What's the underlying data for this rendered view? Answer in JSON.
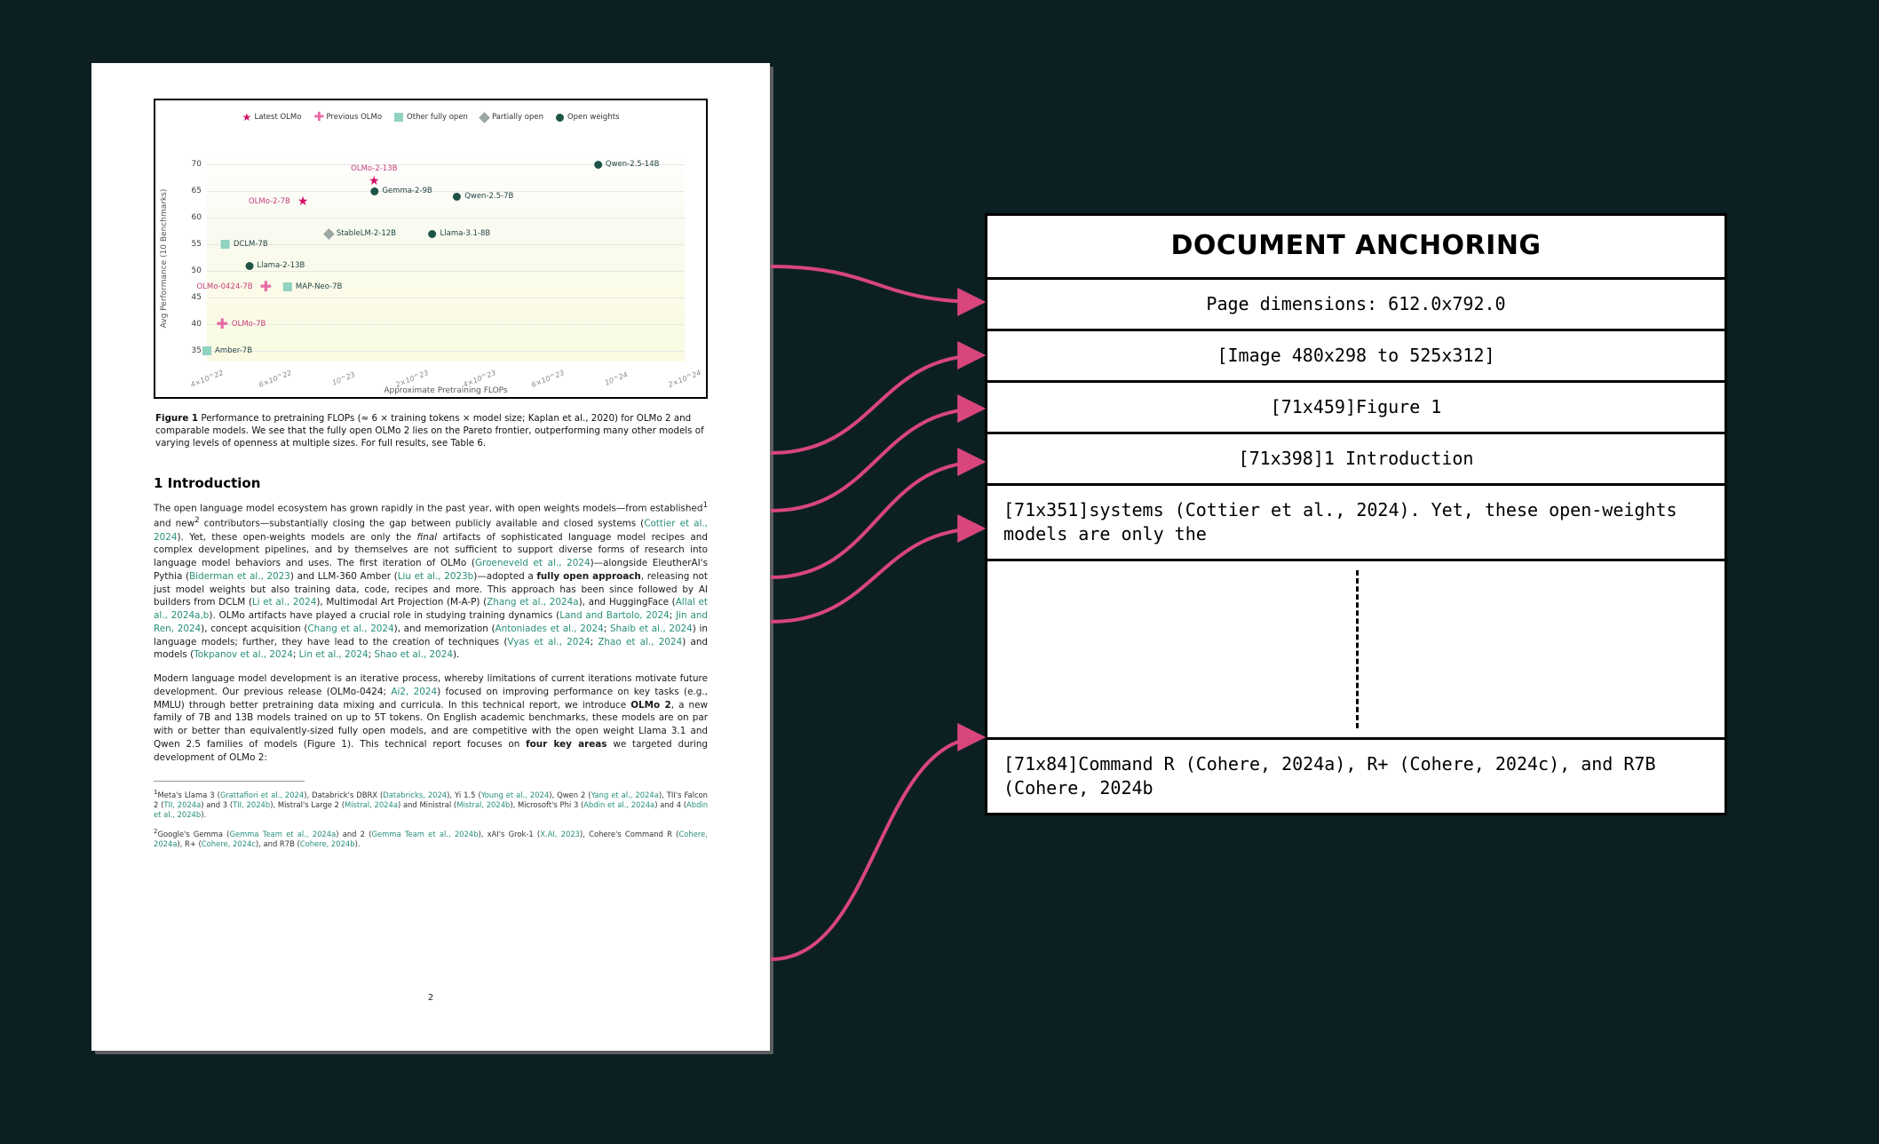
{
  "colors": {
    "bg": "#0c2024",
    "arrow": "#d8467c",
    "teal_link": "#278f7a"
  },
  "chart_data": {
    "type": "scatter",
    "title": "",
    "xlabel": "Approximate Pretraining FLOPs",
    "ylabel": "Avg Performance (10 Benchmarks)",
    "ylim": [
      33,
      73
    ],
    "yticks": [
      35,
      40,
      45,
      50,
      55,
      60,
      65,
      70
    ],
    "x_categories": [
      "4×10^22",
      "6×10^22",
      "10^23",
      "2×10^23",
      "4×10^23",
      "6×10^23",
      "10^24",
      "2×10^24"
    ],
    "legend": [
      {
        "marker": "star",
        "label": "Latest OLMo"
      },
      {
        "marker": "plus",
        "label": "Previous OLMo"
      },
      {
        "marker": "sq",
        "label": "Other fully open"
      },
      {
        "marker": "dia",
        "label": "Partially open"
      },
      {
        "marker": "dot",
        "label": "Open weights"
      }
    ],
    "points": [
      {
        "label": "OLMo-2-13B",
        "marker": "star",
        "xi": 2.45,
        "y": 68,
        "label_color": "pink",
        "label_side": "top"
      },
      {
        "label": "OLMo-2-7B",
        "marker": "star",
        "xi": 1.05,
        "y": 63,
        "label_color": "pink",
        "label_side": "left"
      },
      {
        "label": "Gemma-2-9B",
        "marker": "dot",
        "xi": 2.85,
        "y": 65,
        "label_side": "right"
      },
      {
        "label": "Qwen-2.5-7B",
        "marker": "dot",
        "xi": 4.05,
        "y": 64,
        "label_side": "right"
      },
      {
        "label": "Qwen-2.5-14B",
        "marker": "dot",
        "xi": 6.15,
        "y": 70,
        "label_side": "right"
      },
      {
        "label": "StableLM-2-12B",
        "marker": "dia",
        "xi": 2.25,
        "y": 57,
        "label_side": "right"
      },
      {
        "label": "Llama-3.1-8B",
        "marker": "dot",
        "xi": 3.7,
        "y": 57,
        "label_side": "right"
      },
      {
        "label": "DCLM-7B",
        "marker": "sq",
        "xi": 0.55,
        "y": 55,
        "label_side": "right"
      },
      {
        "label": "Llama-2-13B",
        "marker": "dot",
        "xi": 1.0,
        "y": 51,
        "label_side": "right"
      },
      {
        "label": "OLMo-0424-7B",
        "marker": "plus",
        "xi": 0.4,
        "y": 47,
        "label_color": "pink",
        "label_side": "left"
      },
      {
        "label": "MAP-Neo-7B",
        "marker": "sq",
        "xi": 1.55,
        "y": 47,
        "label_side": "right"
      },
      {
        "label": "OLMo-7B",
        "marker": "plus",
        "xi": 0.5,
        "y": 40,
        "label_color": "pink",
        "label_side": "right"
      },
      {
        "label": "Amber-7B",
        "marker": "sq",
        "xi": 0.3,
        "y": 35,
        "label_side": "right"
      }
    ]
  },
  "caption": {
    "lead": "Figure 1",
    "text": " Performance to pretraining FLOPs (≈ 6 × training tokens × model size; Kaplan et al., 2020) for OLMo 2 and comparable models. We see that the fully open OLMo 2 lies on the Pareto frontier, outperforming many other models of varying levels of openness at multiple sizes. For full results, see Table 6."
  },
  "heading": "1   Introduction",
  "paragraph1_html": "The open language model ecosystem has grown rapidly in the past year, with open weights models—from established<sup>1</sup> and new<sup>2</sup> contributors—substantially closing the gap between publicly available and closed systems (<span class='lk'>Cottier et al., 2024</span>). Yet, these open-weights models are only the <i>final</i> artifacts of sophisticated language model recipes and complex development pipelines, and by themselves are not sufficient to support diverse forms of research into language model behaviors and uses. The first iteration of OLMo (<span class='lk'>Groeneveld et al., 2024</span>)—alongside EleutherAI's Pythia (<span class='lk'>Biderman et al., 2023</span>) and LLM-360 Amber (<span class='lk'>Liu et al., 2023b</span>)—adopted a <b>fully open approach</b>, releasing not just model weights but also training data, code, recipes and more. This approach has been since followed by AI builders from DCLM (<span class='lk'>Li et al., 2024</span>), Multimodal Art Projection (M-A-P) (<span class='lk'>Zhang et al., 2024a</span>), and HuggingFace (<span class='lk'>Allal et al., 2024a,b</span>). OLMo artifacts have played a crucial role in studying training dynamics (<span class='lk'>Land and Bartolo, 2024</span>; <span class='lk'>Jin and Ren, 2024</span>), concept acquisition (<span class='lk'>Chang et al., 2024</span>), and memorization (<span class='lk'>Antoniades et al., 2024</span>; <span class='lk'>Shaib et al., 2024</span>) in language models; further, they have lead to the creation of techniques (<span class='lk'>Vyas et al., 2024</span>; <span class='lk'>Zhao et al., 2024</span>) and models (<span class='lk'>Tokpanov et al., 2024</span>; <span class='lk'>Lin et al., 2024</span>; <span class='lk'>Shao et al., 2024</span>).",
  "paragraph2_html": "Modern language model development is an iterative process, whereby limitations of current iterations motivate future development. Our previous release (OLMo-0424; <span class='lk'>Ai2, 2024</span>) focused on improving performance on key tasks (e.g., MMLU) through better pretraining data mixing and curricula. In this technical report, we introduce <b>OLMo 2</b>, a new family of 7B and 13B models trained on up to 5T tokens. On English academic benchmarks, these models are on par with or better than equivalently-sized fully open models, and are competitive with the open weight Llama 3.1 and Qwen 2.5 families of models (Figure 1). This technical report focuses on <b>four key areas</b> we targeted during development of OLMo 2:",
  "footnote1_html": "<sup>1</sup>Meta's Llama 3 (<span class='lk'>Grattafiori et al., 2024</span>), Databrick's DBRX (<span class='lk'>Databricks, 2024</span>), Yi 1.5 (<span class='lk'>Young et al., 2024</span>), Qwen 2 (<span class='lk'>Yang et al., 2024a</span>), TII's Falcon 2 (<span class='lk'>TII, 2024a</span>) and 3 (<span class='lk'>TII, 2024b</span>), Mistral's Large 2 (<span class='lk'>Mistral, 2024a</span>) and Ministral (<span class='lk'>Mistral, 2024b</span>), Microsoft's Phi 3 (<span class='lk'>Abdin et al., 2024a</span>) and 4 (<span class='lk'>Abdin et al., 2024b</span>).",
  "footnote2_html": "<sup>2</sup>Google's Gemma (<span class='lk'>Gemma Team et al., 2024a</span>) and 2 (<span class='lk'>Gemma Team et al., 2024b</span>), xAI's Grok-1 (<span class='lk'>X.AI, 2023</span>), Cohere's Command R (<span class='lk'>Cohere, 2024a</span>), R+ (<span class='lk'>Cohere, 2024c</span>), and R7B (<span class='lk'>Cohere, 2024b</span>).",
  "page_number": "2",
  "anchoring": {
    "title": "DOCUMENT ANCHORING",
    "rows": [
      "Page dimensions: 612.0x792.0",
      "[Image 480x298 to 525x312]",
      "[71x459]Figure 1",
      "[71x398]1 Introduction",
      "[71x351]systems (Cottier et al., 2024). Yet, these open-weights models are only the",
      "[71x84]Command R (Cohere, 2024a), R+ (Cohere, 2024c), and R7B (Cohere, 2024b"
    ]
  },
  "arrows": [
    {
      "from": [
        868,
        300
      ],
      "to": [
        1107,
        340
      ]
    },
    {
      "from": [
        868,
        510
      ],
      "to": [
        1107,
        400
      ]
    },
    {
      "from": [
        868,
        575
      ],
      "to": [
        1107,
        460
      ]
    },
    {
      "from": [
        868,
        650
      ],
      "to": [
        1107,
        520
      ]
    },
    {
      "from": [
        868,
        700
      ],
      "to": [
        1107,
        595
      ]
    },
    {
      "from": [
        868,
        1080
      ],
      "to": [
        1107,
        830
      ]
    }
  ]
}
